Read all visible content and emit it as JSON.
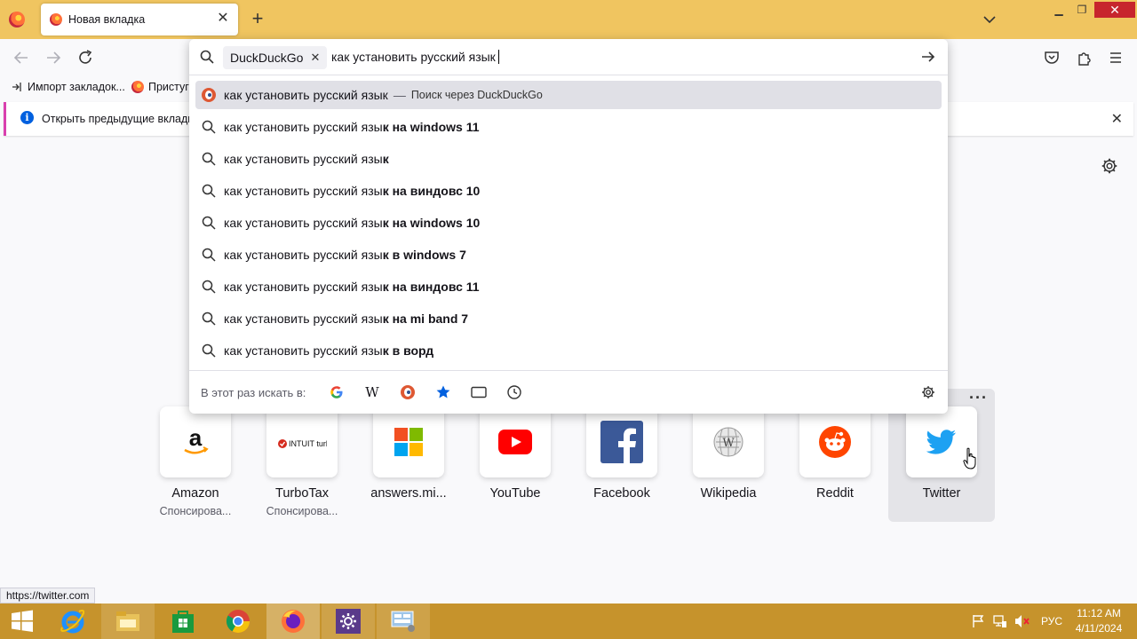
{
  "browser": {
    "tab_title": "Новая вкладка",
    "status_url": "https://twitter.com"
  },
  "bookmarks": [
    {
      "label": "Импорт закладок..."
    },
    {
      "label": "Пристуг"
    }
  ],
  "notification": {
    "text": "Открыть предыдущие вкладки"
  },
  "urlbar": {
    "engine": "DuckDuckGo",
    "query": "как установить русский язык",
    "first_row": {
      "text": "как установить русский язык",
      "dash": "—",
      "note": "Поиск через DuckDuckGo"
    },
    "suggestions": [
      {
        "prefix": "как установить русский язы",
        "bold": "к на windows 11"
      },
      {
        "prefix": "как установить русский язы",
        "bold": "к"
      },
      {
        "prefix": "как установить русский язы",
        "bold": "к на виндовс 10"
      },
      {
        "prefix": "как установить русский язы",
        "bold": "к на windows 10"
      },
      {
        "prefix": "как установить русский язы",
        "bold": "к в windows 7"
      },
      {
        "prefix": "как установить русский язы",
        "bold": "к на виндовс 11"
      },
      {
        "prefix": "как установить русский язы",
        "bold": "к на mi band 7"
      },
      {
        "prefix": "как установить русский язы",
        "bold": "к в ворд"
      }
    ],
    "oneoff_label": "В этот раз искать в:",
    "oneoff_engines": [
      "google-icon",
      "wikipedia-icon",
      "duckduckgo-icon",
      "bookmarks-star-icon",
      "tabs-icon",
      "history-clock-icon"
    ]
  },
  "top_sites": [
    {
      "name": "Amazon",
      "sub": "Спонсирова...",
      "icon": "amazon-icon"
    },
    {
      "name": "TurboTax",
      "sub": "Спонсирова...",
      "icon": "turbotax-icon"
    },
    {
      "name": "answers.mi...",
      "sub": "",
      "icon": "microsoft-icon"
    },
    {
      "name": "YouTube",
      "sub": "",
      "icon": "youtube-icon"
    },
    {
      "name": "Facebook",
      "sub": "",
      "icon": "facebook-icon"
    },
    {
      "name": "Wikipedia",
      "sub": "",
      "icon": "wikipedia-icon"
    },
    {
      "name": "Reddit",
      "sub": "",
      "icon": "reddit-icon"
    },
    {
      "name": "Twitter",
      "sub": "",
      "icon": "twitter-icon"
    }
  ],
  "turbotax_logo_text": "INTUIT turbotax",
  "taskbar": {
    "lang": "РУС",
    "time": "11:12 AM",
    "date": "4/11/2024"
  },
  "colors": {
    "titlebar": "#f0c560",
    "taskbar": "#c6932c",
    "accent": "#0060df"
  }
}
